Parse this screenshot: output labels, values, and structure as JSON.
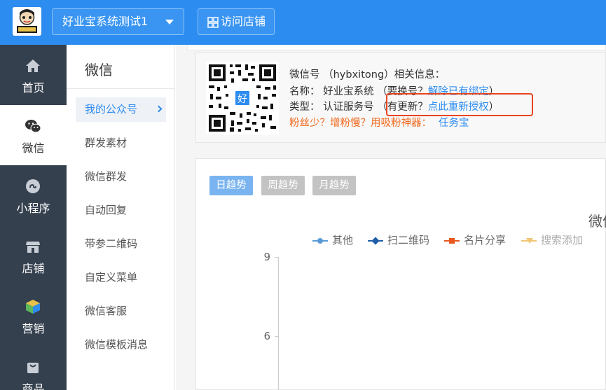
{
  "topbar": {
    "shop_name": "好业宝系统测试1",
    "visit_label": "访问店铺",
    "color": "#2d8cf0"
  },
  "leftnav": {
    "items": [
      {
        "label": "首页",
        "icon": "home-icon"
      },
      {
        "label": "微信",
        "icon": "wechat-icon",
        "active": true
      },
      {
        "label": "小程序",
        "icon": "miniprogram-icon"
      },
      {
        "label": "店铺",
        "icon": "store-icon"
      },
      {
        "label": "营销",
        "icon": "cube-icon"
      },
      {
        "label": "商品",
        "icon": "bag-icon"
      }
    ]
  },
  "subnav": {
    "title": "微信",
    "items": [
      {
        "label": "我的公众号",
        "active": true
      },
      {
        "label": "群发素材"
      },
      {
        "label": "微信群发"
      },
      {
        "label": "自动回复"
      },
      {
        "label": "带参二维码"
      },
      {
        "label": "自定义菜单"
      },
      {
        "label": "微信客服"
      },
      {
        "label": "微信模板消息"
      }
    ]
  },
  "info": {
    "qr_badge": "好",
    "line1": "微信号 （hybxitong）相关信息：",
    "line2_prefix": "名称： 好业宝系统 （要换号？",
    "line2_link": "解除已有绑定",
    "line2_suffix": "）",
    "line3_prefix": "类型： 认证服务号 （有更新？",
    "line3_link": "点此重新授权",
    "line3_suffix": "）",
    "line4_text": "粉丝少？增粉慢？用吸粉神器：",
    "line4_link": "任务宝"
  },
  "chart": {
    "tabs": [
      {
        "label": "日趋势",
        "active": true
      },
      {
        "label": "周趋势"
      },
      {
        "label": "月趋势"
      }
    ],
    "title_visible": "微信",
    "legend": [
      {
        "label": "其他",
        "color": "#5b9bd5",
        "marker": "circle"
      },
      {
        "label": "扫二维码",
        "color": "#1f5fa8",
        "marker": "diamond"
      },
      {
        "label": "名片分享",
        "color": "#e8571e",
        "marker": "square"
      },
      {
        "label": "搜索添加",
        "color": "#f0c674",
        "marker": "triangle"
      }
    ],
    "y_ticks": [
      "9",
      "6"
    ]
  },
  "chart_data": {
    "type": "line",
    "title": "微信",
    "series": [
      {
        "name": "其他",
        "values": []
      },
      {
        "name": "扫二维码",
        "values": []
      },
      {
        "name": "名片分享",
        "values": []
      },
      {
        "name": "搜索添加",
        "values": []
      }
    ],
    "y_ticks": [
      9,
      6
    ],
    "legend_position": "top"
  }
}
